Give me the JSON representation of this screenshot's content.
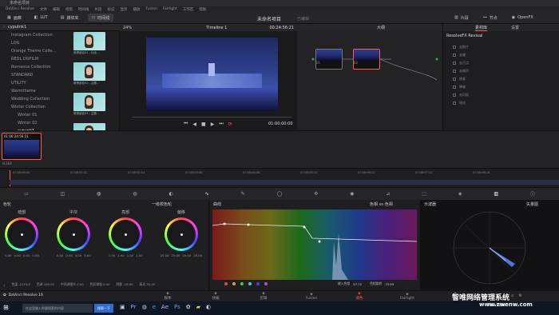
{
  "window": {
    "title": "未命名项目"
  },
  "menu": [
    "DaVinci Resolve",
    "文件",
    "编辑",
    "修剪",
    "时间线",
    "片段",
    "标记",
    "显示",
    "播放",
    "Fusion",
    "Fairlight",
    "工作区",
    "帮助"
  ],
  "toolbar": {
    "gallery": "画廊",
    "lut": "LUT",
    "media": "媒体夹",
    "timeline": "时间线",
    "project": "未命名项目",
    "status": "已编辑",
    "clips": "片段",
    "nodes": "节点",
    "openfx": "OpenFX",
    "lightbox": "光箱"
  },
  "gallery": {
    "album": "cyputnk1",
    "tree": [
      {
        "label": "Instagram Collection",
        "sub": false
      },
      {
        "label": "LOG",
        "sub": false
      },
      {
        "label": "Orange Theme Colle...",
        "sub": false
      },
      {
        "label": "REDL DGFILM",
        "sub": false
      },
      {
        "label": "Romance Collection",
        "sub": false
      },
      {
        "label": "STANDARD",
        "sub": false
      },
      {
        "label": "UTILITY",
        "sub": false
      },
      {
        "label": "Warmtheme",
        "sub": false
      },
      {
        "label": "Wedding Collection",
        "sub": false
      },
      {
        "label": "Winter Collection",
        "sub": false
      },
      {
        "label": "Winter 01",
        "sub": true
      },
      {
        "label": "Winter 02",
        "sub": true
      },
      {
        "label": "cypunk1",
        "sub": true
      }
    ],
    "thumbs": [
      "赛博朋克01...片段...",
      "赛博朋克02...主题...",
      "赛博朋克03...主题...",
      "赛博朋克04...主题..."
    ]
  },
  "viewer": {
    "zoom": "24%",
    "timeline": "Timeline 1",
    "timecode": "00:24:56:21",
    "tc_display": "01:00:00:00"
  },
  "nodes": {
    "zoom": "大纲",
    "node1": "01",
    "node2": "02"
  },
  "openfx": {
    "tabs": [
      "素材库",
      "设置"
    ],
    "title": "ResolveFX Revival",
    "items": [
      "去胶片",
      "去噪",
      "去污点",
      "去噪声",
      "修复",
      "降噪",
      "去闪烁",
      "锐化"
    ]
  },
  "clip": {
    "num": "01",
    "tc": "00:24:56:21",
    "codec": "H.264"
  },
  "timeline": {
    "ticks": [
      "01:00:00:00",
      "01:00:01:02",
      "01:00:02:04",
      "01:00:03:06",
      "01:00:04:08",
      "01:00:05:10",
      "01:00:06:12",
      "01:00:07:14",
      "01:00:08:16"
    ]
  },
  "wheels": {
    "title": "色轮",
    "mode": "一级校色轮",
    "items": [
      {
        "name": "暗部",
        "vals": [
          "0.00",
          "0.00",
          "0.00",
          "0.00"
        ]
      },
      {
        "name": "中灰",
        "vals": [
          "0.00",
          "0.00",
          "0.00",
          "0.00"
        ]
      },
      {
        "name": "亮部",
        "vals": [
          "1.00",
          "1.00",
          "1.00",
          "1.00"
        ]
      },
      {
        "name": "偏移",
        "vals": [
          "25.00",
          "25.00",
          "25.00",
          "25.00"
        ]
      }
    ],
    "footer": [
      "1",
      "色温 -2170.0",
      "色调 100.00",
      "中间调细节 0.00",
      "色彩增强 0.00",
      "阴影 -16.50",
      "高光 32.00"
    ]
  },
  "curves": {
    "title": "曲线",
    "mode": "色相 vs 色相",
    "input_label": "输入色相",
    "input": "57.72",
    "output_label": "色相旋转",
    "output": "73.93"
  },
  "scope": {
    "title": "示波器",
    "mode": "矢量图"
  },
  "pages": {
    "app": "DaVinci Resolve 16",
    "tabs": [
      {
        "label": "媒体",
        "active": false
      },
      {
        "label": "快编",
        "active": false
      },
      {
        "label": "剪辑",
        "active": false
      },
      {
        "label": "Fusion",
        "active": false
      },
      {
        "label": "调色",
        "active": true
      },
      {
        "label": "Fairlight",
        "active": false
      },
      {
        "label": "交付",
        "active": false
      }
    ]
  },
  "taskbar": {
    "search": "在这里输入你要搜索的内容",
    "task": "搜索一下",
    "date": "2019/12/21",
    "time": "22:01",
    "watermark": "智唯网络管理系统",
    "url": "www.zwenw.com"
  },
  "colors": {
    "accent": "#ff5a5a",
    "panel": "#1f1f22"
  }
}
